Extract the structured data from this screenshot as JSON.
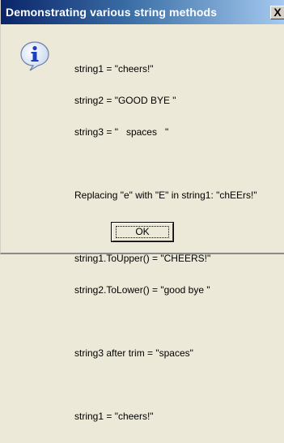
{
  "window": {
    "title": "Demonstrating various string methods",
    "close_label": "X"
  },
  "icon": "information-icon",
  "message": {
    "lines": [
      "string1 = \"cheers!\"",
      "string2 = \"GOOD BYE \"",
      "string3 = \"   spaces   \"",
      "",
      "Replacing \"e\" with \"E\" in string1: \"chEErs!\"",
      "",
      "string1.ToUpper() = \"CHEERS!\"",
      "string2.ToLower() = \"good bye \"",
      "",
      "string3 after trim = \"spaces\"",
      "",
      "string1 = \"cheers!\""
    ]
  },
  "buttons": {
    "ok_label": "OK"
  }
}
